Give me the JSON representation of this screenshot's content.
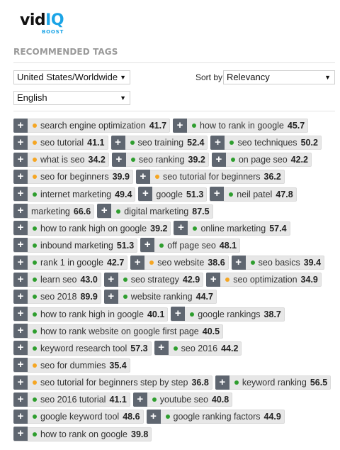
{
  "brand": {
    "name_part1": "vid",
    "name_part2": "IQ",
    "sub": "BOOST"
  },
  "section_title": "RECOMMENDED TAGS",
  "controls": {
    "country": "United States/Worldwide",
    "language": "English",
    "sort_label": "Sort by",
    "sort_value": "Relevancy"
  },
  "colors": {
    "green": "#2e9e2e",
    "orange": "#f5a623",
    "plus_bg": "#5f6670",
    "brand_blue": "#1ba4e6"
  },
  "tag_rows": [
    [
      {
        "label": "search engine optimization",
        "score": "41.7",
        "dot": "orange"
      },
      {
        "label": "how to rank in google",
        "score": "45.7",
        "dot": "green"
      }
    ],
    [
      {
        "label": "seo tutorial",
        "score": "41.1",
        "dot": "orange"
      },
      {
        "label": "seo training",
        "score": "52.4",
        "dot": "green"
      },
      {
        "label": "seo techniques",
        "score": "50.2",
        "dot": "green"
      }
    ],
    [
      {
        "label": "what is seo",
        "score": "34.2",
        "dot": "orange"
      },
      {
        "label": "seo ranking",
        "score": "39.2",
        "dot": "green"
      },
      {
        "label": "on page seo",
        "score": "42.2",
        "dot": "green"
      }
    ],
    [
      {
        "label": "seo for beginners",
        "score": "39.9",
        "dot": "orange"
      },
      {
        "label": "seo tutorial for beginners",
        "score": "36.2",
        "dot": "orange"
      }
    ],
    [
      {
        "label": "internet marketing",
        "score": "49.4",
        "dot": "green"
      },
      {
        "label": "google",
        "score": "51.3",
        "dot": "none"
      },
      {
        "label": "neil patel",
        "score": "47.8",
        "dot": "green"
      }
    ],
    [
      {
        "label": "marketing",
        "score": "66.6",
        "dot": "none"
      },
      {
        "label": "digital marketing",
        "score": "87.5",
        "dot": "green"
      }
    ],
    [
      {
        "label": "how to rank high on google",
        "score": "39.2",
        "dot": "green"
      },
      {
        "label": "online marketing",
        "score": "57.4",
        "dot": "green"
      }
    ],
    [
      {
        "label": "inbound marketing",
        "score": "51.3",
        "dot": "green"
      },
      {
        "label": "off page seo",
        "score": "48.1",
        "dot": "green"
      }
    ],
    [
      {
        "label": "rank 1 in google",
        "score": "42.7",
        "dot": "green"
      },
      {
        "label": "seo website",
        "score": "38.6",
        "dot": "orange"
      },
      {
        "label": "seo basics",
        "score": "39.4",
        "dot": "green"
      }
    ],
    [
      {
        "label": "learn seo",
        "score": "43.0",
        "dot": "green"
      },
      {
        "label": "seo strategy",
        "score": "42.9",
        "dot": "green"
      },
      {
        "label": "seo optimization",
        "score": "34.9",
        "dot": "orange"
      }
    ],
    [
      {
        "label": "seo 2018",
        "score": "89.9",
        "dot": "green"
      },
      {
        "label": "website ranking",
        "score": "44.7",
        "dot": "green"
      }
    ],
    [
      {
        "label": "how to rank high in google",
        "score": "40.1",
        "dot": "green"
      },
      {
        "label": "google rankings",
        "score": "38.7",
        "dot": "green"
      }
    ],
    [
      {
        "label": "how to rank website on google first page",
        "score": "40.5",
        "dot": "green"
      }
    ],
    [
      {
        "label": "keyword research tool",
        "score": "57.3",
        "dot": "green"
      },
      {
        "label": "seo 2016",
        "score": "44.2",
        "dot": "green"
      }
    ],
    [
      {
        "label": "seo for dummies",
        "score": "35.4",
        "dot": "orange"
      }
    ],
    [
      {
        "label": "seo tutorial for beginners step by step",
        "score": "36.8",
        "dot": "orange"
      },
      {
        "label": "keyword ranking",
        "score": "56.5",
        "dot": "green"
      }
    ],
    [
      {
        "label": "seo 2016 tutorial",
        "score": "41.1",
        "dot": "green"
      },
      {
        "label": "youtube seo",
        "score": "40.8",
        "dot": "green"
      }
    ],
    [
      {
        "label": "google keyword tool",
        "score": "48.6",
        "dot": "green"
      },
      {
        "label": "google ranking factors",
        "score": "44.9",
        "dot": "green"
      }
    ],
    [
      {
        "label": "how to rank on google",
        "score": "39.8",
        "dot": "green"
      }
    ]
  ]
}
